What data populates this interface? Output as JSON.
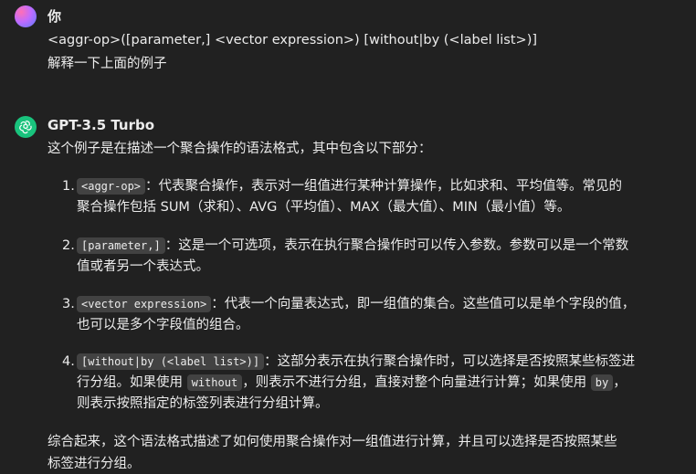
{
  "user": {
    "name": "你",
    "lines": [
      "<aggr-op>([parameter,] <vector expression>) [without|by (<label list>)]",
      "解释一下上面的例子"
    ]
  },
  "assistant": {
    "name": "GPT-3.5 Turbo",
    "intro": "这个例子是在描述一个聚合操作的语法格式，其中包含以下部分：",
    "items": [
      {
        "num": "1.",
        "code": "<aggr-op>",
        "l1": "：代表聚合操作，表示对一组值进行某种计算操作，比如求和、平均值等。常见的",
        "l2": "聚合操作包括 SUM（求和）、AVG（平均值）、MAX（最大值）、MIN（最小值）等。"
      },
      {
        "num": "2.",
        "code": "[parameter,]",
        "l1": "：这是一个可选项，表示在执行聚合操作时可以传入参数。参数可以是一个常数",
        "l2": "值或者另一个表达式。"
      },
      {
        "num": "3.",
        "code": "<vector expression>",
        "l1": "：代表一个向量表达式，即一组值的集合。这些值可以是单个字段的值，",
        "l2": "也可以是多个字段值的组合。"
      },
      {
        "num": "4.",
        "code": "[without|by (<label list>)]",
        "l1": "：这部分表示在执行聚合操作时，可以选择是否按照某些标签进",
        "l2a": "行分组。如果使用 ",
        "code2": "without",
        "l2b": "，则表示不进行分组，直接对整个向量进行计算；如果使用 ",
        "code3": "by",
        "l2c": "，",
        "l3": "则表示按照指定的标签列表进行分组计算。"
      }
    ],
    "summary": [
      "综合起来，这个语法格式描述了如何使用聚合操作对一组值进行计算，并且可以选择是否按照某些",
      "标签进行分组。"
    ]
  }
}
